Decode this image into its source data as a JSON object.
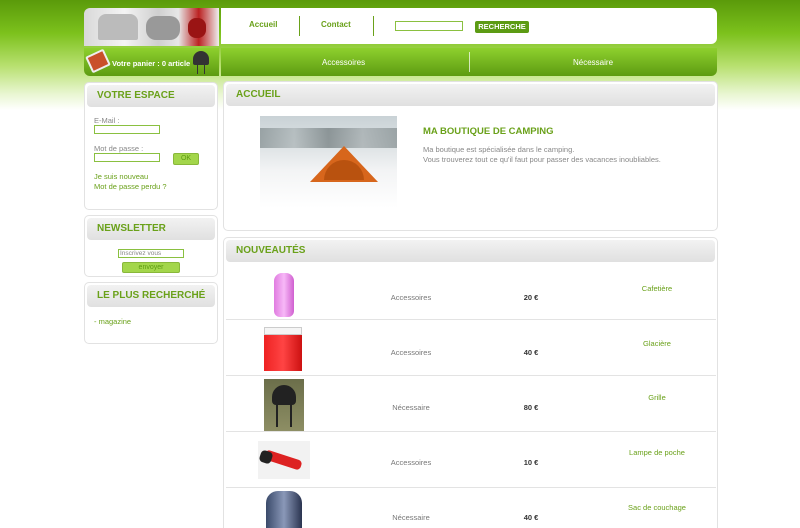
{
  "header": {
    "nav": [
      "Accueil",
      "Contact"
    ],
    "search": {
      "value": "",
      "button": "RECHERCHE"
    },
    "cart": "Votre panier : 0 article",
    "categories": [
      "Accessoires",
      "Nécessaire"
    ]
  },
  "sidebar": {
    "espace": {
      "title": "VOTRE ESPACE",
      "email_label": "E-Mail :",
      "password_label": "Mot de passe :",
      "ok": "OK",
      "new_link": "Je suis nouveau",
      "lost_link": "Mot de passe perdu ?"
    },
    "newsletter": {
      "title": "NEWSLETTER",
      "input_value": "Inscrivez vous",
      "button": "envoyer"
    },
    "popular": {
      "title": "LE PLUS RECHERCHÉ",
      "item": "- magazine"
    }
  },
  "main": {
    "accueil_title": "ACCUEIL",
    "shop_title": "MA BOUTIQUE DE CAMPING",
    "shop_desc_1": "Ma boutique est spécialisée dans le camping.",
    "shop_desc_2": "Vous trouverez tout ce qu'il faut pour passer des vacances inoubliables.",
    "news_title": "NOUVEAUTÉS",
    "products": [
      {
        "category": "Accessoires",
        "price": "20 €",
        "name": "Cafetière"
      },
      {
        "category": "Accessoires",
        "price": "40 €",
        "name": "Glacière"
      },
      {
        "category": "Nécessaire",
        "price": "80 €",
        "name": "Grille"
      },
      {
        "category": "Accessoires",
        "price": "10 €",
        "name": "Lampe de poche"
      },
      {
        "category": "Nécessaire",
        "price": "40 €",
        "name": "Sac de couchage"
      }
    ]
  },
  "colors": {
    "accent": "#6aa11a",
    "bar": "#5d9b12"
  }
}
